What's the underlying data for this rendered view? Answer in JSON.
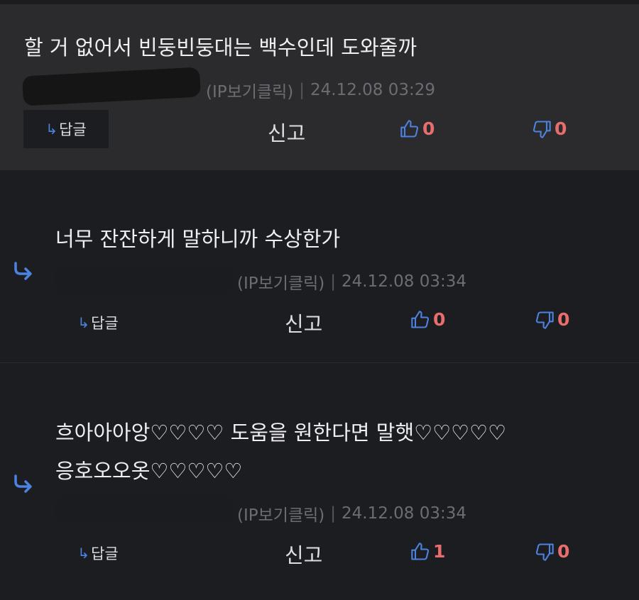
{
  "comments": [
    {
      "text_lines": [
        "할 거 없어서 빈둥빈둥대는 백수인데 도와줄까"
      ],
      "ip_label": "(IP보기클릭)",
      "timestamp": "24.12.08 03:29",
      "reply_label": "답글",
      "report_label": "신고",
      "likes": "0",
      "dislikes": "0"
    },
    {
      "text_lines": [
        "너무 잔잔하게 말하니까 수상한가"
      ],
      "ip_label": "(IP보기클릭)",
      "timestamp": "24.12.08 03:34",
      "reply_label": "답글",
      "report_label": "신고",
      "likes": "0",
      "dislikes": "0"
    },
    {
      "text_lines": [
        "흐아아아앙♡♡♡♡ 도움을 원한다면 말햇♡♡♡♡♡",
        "응호오오옷♡♡♡♡♡"
      ],
      "ip_label": "(IP보기클릭)",
      "timestamp": "24.12.08 03:34",
      "reply_label": "답글",
      "report_label": "신고",
      "likes": "1",
      "dislikes": "0"
    }
  ],
  "colors": {
    "accent": "#4e82e0",
    "vote_count": "#e86d6d",
    "meta": "#6c6d73"
  },
  "icons": {
    "reply_indicator": "reply-arrow-icon",
    "like": "thumbs-up-icon",
    "dislike": "thumbs-down-icon"
  }
}
